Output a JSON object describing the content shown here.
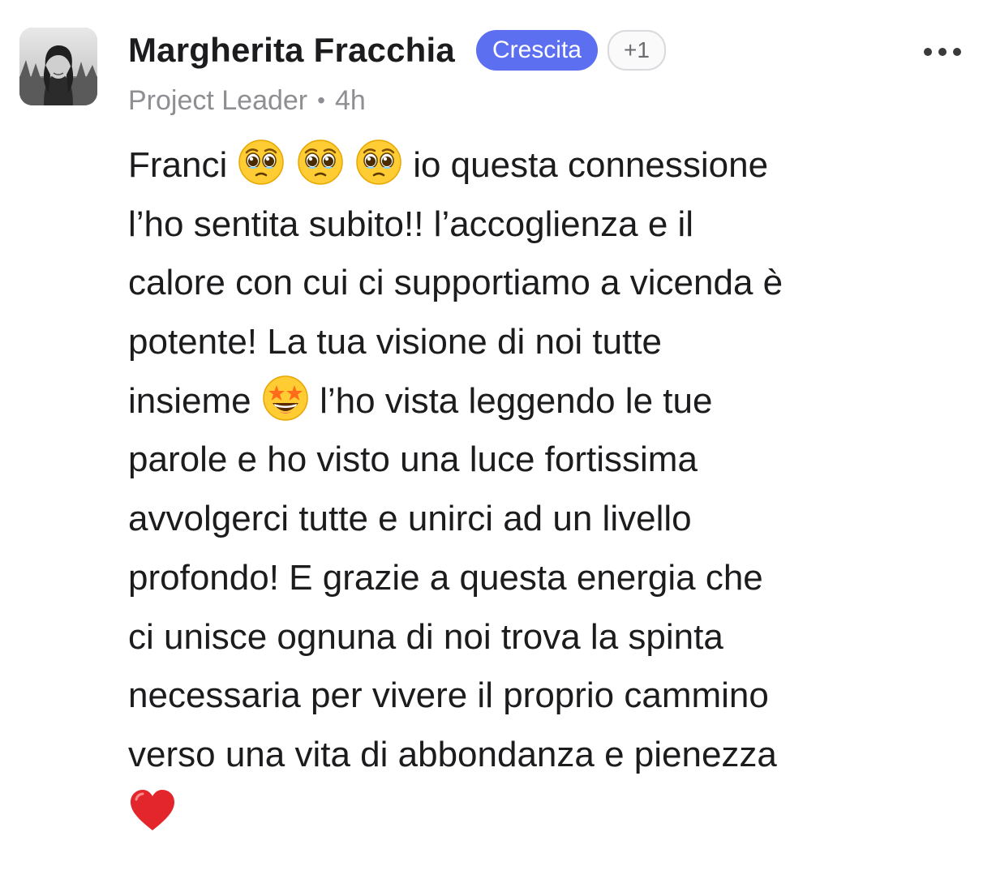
{
  "post": {
    "author": {
      "name": "Margherita Fracchia",
      "role": "Project Leader",
      "time": "4h",
      "avatar_icon": "avatar-photo"
    },
    "badges": {
      "primary": "Crescita",
      "extra": "+1"
    },
    "separator": "•",
    "more_icon": "ellipsis-icon",
    "colors": {
      "badge_bg": "#5b6ff0",
      "meta_text": "#8e8e93",
      "body_text": "#1c1c1e"
    },
    "body": {
      "line1_a": "Franci",
      "line1_b": "io questa connessione",
      "line2": "l’ho sentita subito!! l’accoglienza e il",
      "line3": "calore con cui ci supportiamo a vicenda è",
      "line4": "potente! La tua visione di noi tutte",
      "line5_a": "insieme",
      "line5_b": "l’ho vista leggendo le tue",
      "line6": "parole e ho visto una luce fortissima",
      "line7": "avvolgerci tutte e unirci ad un livello",
      "line8": "profondo! E grazie a questa energia che",
      "line9": "ci unisce ognuna di noi trova la spinta",
      "line10": "necessaria per vivere il proprio cammino",
      "line11": "verso una vita di abbondanza e pienezza"
    },
    "emojis": [
      "pleading-face-icon",
      "pleading-face-icon",
      "pleading-face-icon",
      "star-struck-icon",
      "red-heart-icon"
    ]
  }
}
